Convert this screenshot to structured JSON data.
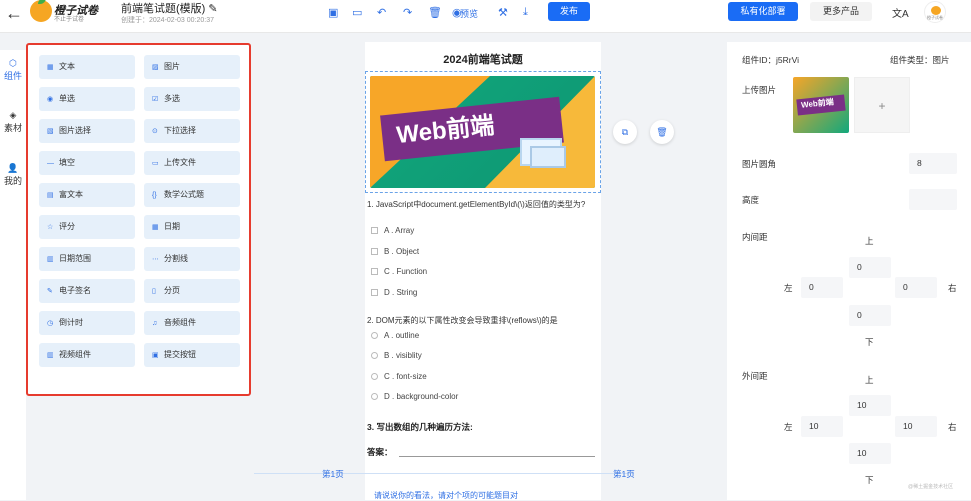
{
  "topbar": {
    "logo_title": "橙子试卷",
    "logo_sub": "不止于试卷",
    "doc_title": "前端笔试题(模版)",
    "created": "创建于：2024-02-03 00:20:37",
    "preview": "预览",
    "publish": "发布",
    "private_deploy": "私有化部署",
    "more_products": "更多产品",
    "avatar_text": "橙子试卷",
    "icons": [
      "back-arrow",
      "edit",
      "save",
      "monitor",
      "undo",
      "redo",
      "delete",
      "eye",
      "wrench",
      "download",
      "translate"
    ]
  },
  "leftnav": {
    "items": [
      {
        "icon": "cube",
        "label": "组件"
      },
      {
        "icon": "layers",
        "label": "素材"
      },
      {
        "icon": "user",
        "label": "我的"
      }
    ]
  },
  "components": [
    {
      "icon": "text",
      "label": "文本"
    },
    {
      "icon": "image",
      "label": "图片"
    },
    {
      "icon": "radio",
      "label": "单选"
    },
    {
      "icon": "checkbox",
      "label": "多选"
    },
    {
      "icon": "image-select",
      "label": "图片选择"
    },
    {
      "icon": "dropdown",
      "label": "下拉选择"
    },
    {
      "icon": "fill",
      "label": "填空"
    },
    {
      "icon": "upload",
      "label": "上传文件"
    },
    {
      "icon": "richtext",
      "label": "富文本"
    },
    {
      "icon": "formula",
      "label": "数学公式题"
    },
    {
      "icon": "star",
      "label": "评分"
    },
    {
      "icon": "calendar",
      "label": "日期"
    },
    {
      "icon": "daterange",
      "label": "日期范围"
    },
    {
      "icon": "divider",
      "label": "分割线"
    },
    {
      "icon": "signature",
      "label": "电子签名"
    },
    {
      "icon": "page",
      "label": "分页"
    },
    {
      "icon": "timer",
      "label": "倒计时"
    },
    {
      "icon": "audio",
      "label": "音频组件"
    },
    {
      "icon": "video",
      "label": "视频组件"
    },
    {
      "icon": "submit",
      "label": "提交按钮"
    }
  ],
  "canvas": {
    "title": "2024前端笔试题",
    "banner_text": "Web前端",
    "q1": "1. JavaScript中document.getElementById\\(\\)返回值的类型为?",
    "q1_options": [
      "A . Array",
      "B . Object",
      "C . Function",
      "D . String"
    ],
    "q2": "2. DOM元素的以下属性改变会导致重排\\(reflows\\)的是",
    "q2_options": [
      "A . outline",
      "B . visiblity",
      "C . font-size",
      "D . background-color"
    ],
    "q3": "3. 写出数组的几种遍历方法:",
    "answer_label": "答案：",
    "page_left": "第1页",
    "page_right": "第1页",
    "bottom_text": "请说说你的看法，请对个项的可能题目对"
  },
  "props": {
    "component_id": "组件ID：j5RrVi",
    "component_type": "组件类型：图片",
    "upload_image": "上传图片",
    "thumb_text": "Web前端",
    "radius_label": "图片圆角",
    "radius_value": "8",
    "height_label": "高度",
    "height_value": "",
    "padding_label": "内间距",
    "margin_label": "外间距",
    "top": "上",
    "bottom": "下",
    "left": "左",
    "right": "右",
    "padding": {
      "top": "0",
      "left": "0",
      "right": "0",
      "bottom": "0"
    },
    "margin": {
      "top": "10",
      "left": "10",
      "right": "10",
      "bottom": "10"
    }
  },
  "watermark": "@稀土掘金技术社区",
  "colors": {
    "accent": "#1a6cf5",
    "highlight_border": "#e63b2e",
    "comp_bg": "#e6f0fa"
  }
}
